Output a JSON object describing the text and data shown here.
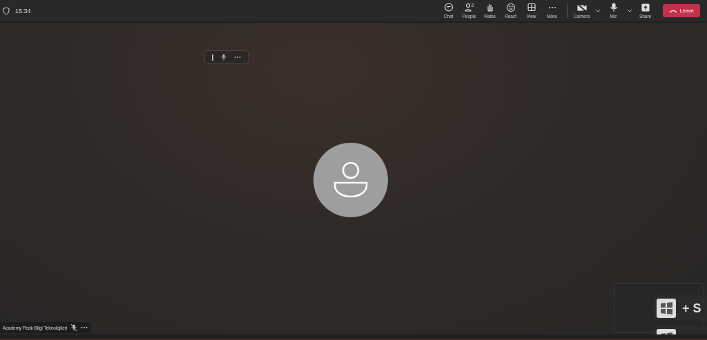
{
  "top_bar": {
    "time": "15:34"
  },
  "toolbar": [
    {
      "label": "Chat",
      "dropdown": false
    },
    {
      "label": "People",
      "badge": "2",
      "dropdown": false
    },
    {
      "label": "Raise",
      "dropdown": false
    },
    {
      "label": "React",
      "dropdown": false
    },
    {
      "label": "View",
      "dropdown": false
    },
    {
      "label": "More",
      "dropdown": false
    },
    {
      "label": "Camera",
      "dropdown": true
    },
    {
      "label": "Mic",
      "dropdown": true
    },
    {
      "label": "Share",
      "dropdown": false
    }
  ],
  "leave_button": {
    "label": "Leave"
  },
  "participant": {
    "name": "Academy Peak Bilgi Teknolojileri"
  },
  "shortcut_hints": [
    {
      "text": "+ S"
    }
  ]
}
